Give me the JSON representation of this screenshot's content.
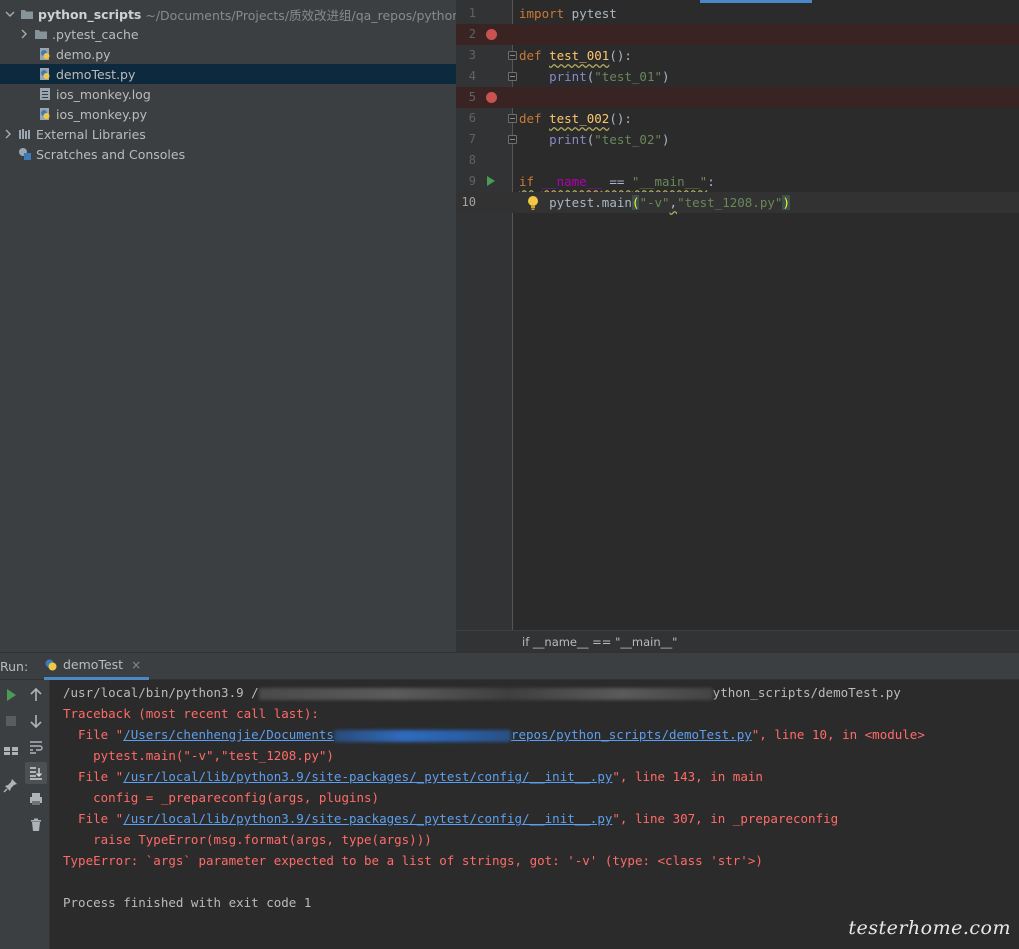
{
  "project": {
    "root_name": "python_scripts",
    "root_path": "~/Documents/Projects/质效改进组/qa_repos/python_sc",
    "items": [
      {
        "label": "python_scripts",
        "icon": "folder-icon"
      },
      {
        "label": ".pytest_cache",
        "icon": "folder-icon"
      },
      {
        "label": "demo.py",
        "icon": "python-file-icon"
      },
      {
        "label": "demoTest.py",
        "icon": "python-file-icon"
      },
      {
        "label": "ios_monkey.log",
        "icon": "text-file-icon"
      },
      {
        "label": "ios_monkey.py",
        "icon": "python-file-icon"
      },
      {
        "label": "External Libraries",
        "icon": "library-icon"
      },
      {
        "label": "Scratches and Consoles",
        "icon": "scratches-icon"
      }
    ],
    "selected": "demoTest.py"
  },
  "editor": {
    "line_numbers": [
      "1",
      "2",
      "3",
      "4",
      "5",
      "6",
      "7",
      "8",
      "9",
      "10"
    ],
    "code": {
      "l1_kw": "import",
      "l1_rest": " pytest",
      "l3_kw": "def",
      "l3_fn": "test_001",
      "l3_rest": "():",
      "l4_indent": "    ",
      "l4_bi": "print",
      "l4_open": "(",
      "l4_str": "\"test_01\"",
      "l4_close": ")",
      "l6_kw": "def",
      "l6_fn": "test_002",
      "l6_rest": "():",
      "l7_indent": "    ",
      "l7_bi": "print",
      "l7_open": "(",
      "l7_str": "\"test_02\"",
      "l7_close": ")",
      "l9_kw": "if",
      "l9_dunder": "__name__",
      "l9_eq": " == ",
      "l9_str": "\"__main__\"",
      "l9_colon": ":",
      "l10_indent": "    ",
      "l10_call": "pytest.main",
      "l10_open": "(",
      "l10_str1": "\"-v\"",
      "l10_comma": ",",
      "l10_str2": "\"test_1208.py\"",
      "l10_close": ")"
    },
    "breadcrumb": "if __name__ == \"__main__\""
  },
  "run": {
    "label": "Run:",
    "tab_label": "demoTest",
    "tab_close": "×"
  },
  "console": {
    "cmd_prefix": "/usr/local/bin/python3.9 /",
    "cmd_suffix": "ython_scripts/demoTest.py",
    "traceback_header": "Traceback (most recent call last):",
    "frame1_file_prefix": "  File \"",
    "frame1_link_a": "/Users/chenhengjie/Documents",
    "frame1_link_b": "repos/python_scripts/demoTest.py",
    "frame1_tail": "\", line 10, in <module>",
    "frame1_code": "    pytest.main(\"-v\",\"test_1208.py\")",
    "frame2_file_prefix": "  File \"",
    "frame2_link": "/usr/local/lib/python3.9/site-packages/_pytest/config/__init__.py",
    "frame2_tail": "\", line 143, in main",
    "frame2_code": "    config = _prepareconfig(args, plugins)",
    "frame3_file_prefix": "  File \"",
    "frame3_link": "/usr/local/lib/python3.9/site-packages/_pytest/config/__init__.py",
    "frame3_tail": "\", line 307, in _prepareconfig",
    "frame3_code": "    raise TypeError(msg.format(args, type(args)))",
    "error_line": "TypeError: `args` parameter expected to be a list of strings, got: '-v' (type: <class 'str'>)",
    "exit_line": "Process finished with exit code 1"
  },
  "watermark": "testerhome.com",
  "colors": {
    "accent": "#4a88c7",
    "error": "#ff6b68",
    "link": "#5c9ff0",
    "breakpoint": "#c75450",
    "run_green": "#499c54"
  }
}
